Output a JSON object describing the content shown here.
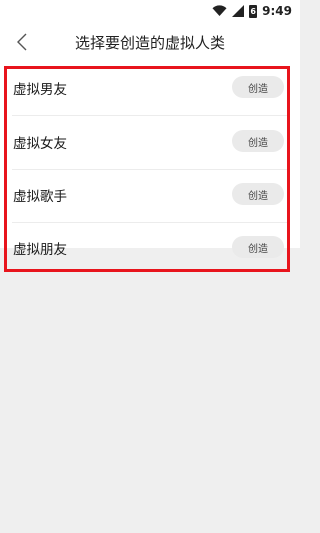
{
  "status_bar": {
    "time": "9:49",
    "battery_label": "6",
    "icons": [
      "wifi-icon",
      "signal-icon",
      "battery-icon"
    ]
  },
  "header": {
    "back_icon": "chevron-left-icon",
    "title": "选择要创造的虚拟人类"
  },
  "options": [
    {
      "label": "虚拟男友",
      "button": "创造"
    },
    {
      "label": "虚拟女友",
      "button": "创造"
    },
    {
      "label": "虚拟歌手",
      "button": "创造"
    },
    {
      "label": "虚拟朋友",
      "button": "创造"
    }
  ],
  "colors": {
    "background": "#efefef",
    "surface": "#ffffff",
    "button_bg": "#eaeaea",
    "highlight": "#e8141c"
  }
}
